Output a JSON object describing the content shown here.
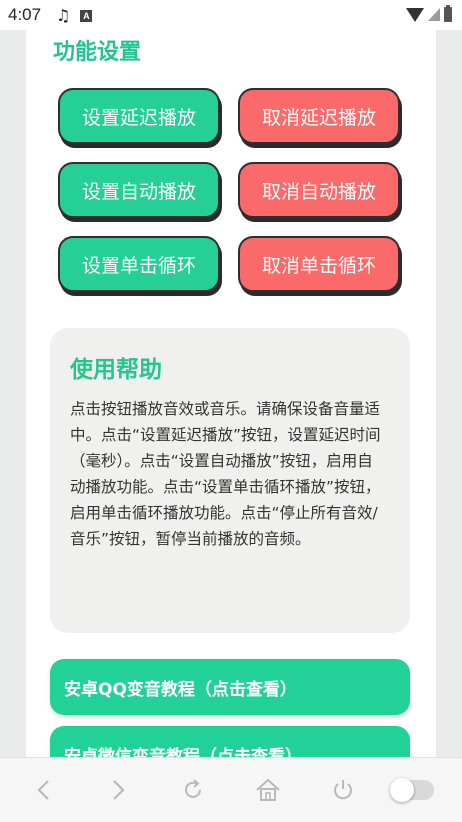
{
  "status_bar": {
    "time": "4:07",
    "a_label": "A"
  },
  "section": {
    "title": "功能设置"
  },
  "buttons": {
    "set_delay": "设置延迟播放",
    "cancel_delay": "取消延迟播放",
    "set_auto": "设置自动播放",
    "cancel_auto": "取消自动播放",
    "set_loop": "设置单击循环",
    "cancel_loop": "取消单击循环"
  },
  "help": {
    "title": "使用帮助",
    "text": "点击按钮播放音效或音乐。请确保设备音量适中。点击“设置延迟播放”按钮，设置延迟时间（毫秒）。点击“设置自动播放”按钮，启用自动播放功能。点击“设置单击循环播放”按钮，启用单击循环播放功能。点击“停止所有音效/音乐”按钮，暂停当前播放的音频。"
  },
  "links": {
    "qq_tutorial": "安卓QQ变音教程（点击查看）",
    "wechat_tutorial": "安卓微信变音教程（点击查看）"
  },
  "colors": {
    "accent_green": "#26cf96",
    "accent_red": "#fb6a6a",
    "title_green": "#22c58f"
  },
  "icons": {
    "status": [
      "music-note-icon",
      "a-notification-icon",
      "wifi-icon",
      "signal-icon",
      "battery-icon"
    ],
    "bottom": [
      "back-icon",
      "forward-icon",
      "refresh-icon",
      "home-icon",
      "power-icon",
      "toggle-switch"
    ]
  }
}
